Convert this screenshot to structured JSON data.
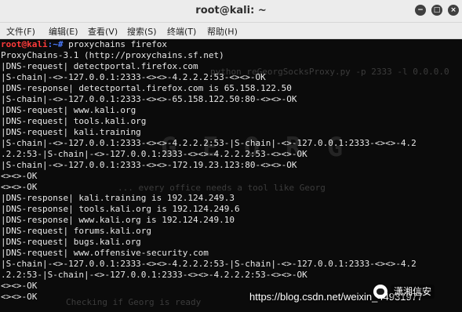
{
  "window": {
    "title": "root@kali: ~",
    "buttons": {
      "minimize": "−",
      "maximize": "□",
      "close": "×"
    }
  },
  "menu": [
    "文件(F)",
    "编辑(E)",
    "查看(V)",
    "搜索(S)",
    "终端(T)",
    "帮助(H)"
  ],
  "terminal": {
    "prompt_user": "root@kali",
    "prompt_path": ":~#",
    "command": " proxychains firefox",
    "lines": [
      "ProxyChains-3.1 (http://proxychains.sf.net)",
      "|DNS-request| detectportal.firefox.com",
      "|S-chain|-<>-127.0.0.1:2333-<><>-4.2.2.2:53-<><>-OK",
      "|DNS-response| detectportal.firefox.com is 65.158.122.50",
      "|S-chain|-<>-127.0.0.1:2333-<><>-65.158.122.50:80-<><>-OK",
      "|DNS-request| www.kali.org",
      "|DNS-request| tools.kali.org",
      "|DNS-request| kali.training",
      "|S-chain|-<>-127.0.0.1:2333-<><>-4.2.2.2:53-|S-chain|-<>-127.0.0.1:2333-<><>-4.2",
      ".2.2:53-|S-chain|-<>-127.0.0.1:2333-<><>-4.2.2.2:53-<><>-OK",
      "|S-chain|-<>-127.0.0.1:2333-<><>-172.19.23.123:80-<><>-OK",
      "<><>-OK",
      "<><>-OK",
      "|DNS-response| kali.training is 192.124.249.3",
      "|DNS-response| tools.kali.org is 192.124.249.6",
      "|DNS-response| www.kali.org is 192.124.249.10",
      "|DNS-request| forums.kali.org",
      "|DNS-request| bugs.kali.org",
      "|DNS-request| www.offensive-security.com",
      "|S-chain|-<>-127.0.0.1:2333-<><>-4.2.2.2:53-|S-chain|-<>-127.0.0.1:2333-<><>-4.2",
      ".2.2:53-|S-chain|-<>-127.0.0.1:2333-<><>-4.2.2.2:53-<><>-OK",
      "<><>-OK",
      "<><>-OK"
    ],
    "background": {
      "cmd": "python reGeorgSocksProxy.py -p 2333 -l 0.0.0.0",
      "banner": "... every office needs a tool like Georg",
      "status": "Checking if Georg is ready"
    }
  },
  "watermark": {
    "url": "https://blog.csdn.net/weixin_44931977",
    "badge": "潇湘信安"
  },
  "colors": {
    "terminal_bg": "#0b0b0b",
    "terminal_fg": "#e8e8e8",
    "prompt_user": "#ff3b3b",
    "prompt_path": "#4b7bff",
    "titlebar": "#ececec"
  },
  "icons": {
    "minimize": "minimize-icon",
    "maximize": "maximize-icon",
    "close": "close-icon",
    "watermark_logo": "wechat-icon"
  }
}
